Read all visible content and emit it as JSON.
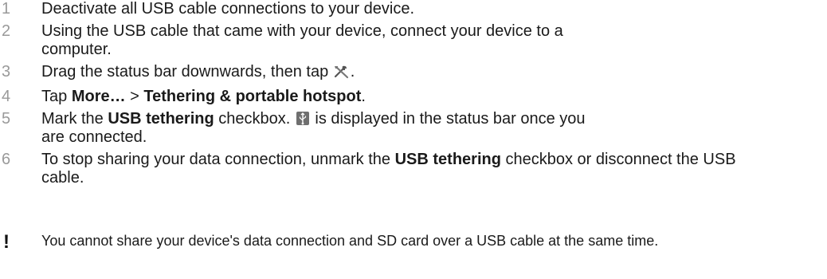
{
  "steps": [
    {
      "num": "1",
      "text": "Deactivate all USB cable connections to your device."
    },
    {
      "num": "2",
      "text": "Using the USB cable that came with your device, connect your device to a computer."
    },
    {
      "num": "3",
      "before": "Drag the status bar downwards, then tap ",
      "after": ".",
      "icon": "settings-tools-icon"
    },
    {
      "num": "4",
      "before": "Tap ",
      "b1": "More…",
      "mid": " > ",
      "b2": "Tethering & portable hotspot",
      "after": "."
    },
    {
      "num": "5",
      "before": "Mark the ",
      "b1": "USB tethering",
      "mid": " checkbox. ",
      "after": " is displayed in the status bar once you are connected.",
      "icon": "usb-tethering-status-icon"
    },
    {
      "num": "6",
      "before": "To stop sharing your data connection, unmark the ",
      "b1": "USB tethering",
      "after": " checkbox or disconnect the USB cable."
    }
  ],
  "note": {
    "icon": "exclamation-note-icon",
    "symbol": "!",
    "text": "You cannot share your device's data connection and SD card over a USB cable at the same time."
  }
}
